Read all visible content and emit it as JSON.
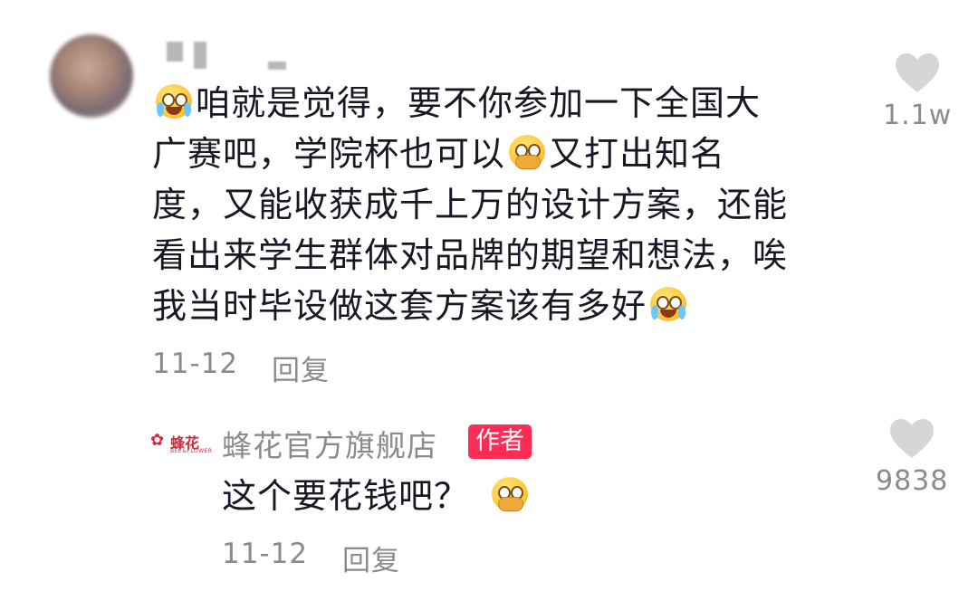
{
  "comment": {
    "text_lines": [
      [
        "咱就是觉得，要不你参加一下全国大"
      ],
      [
        "广赛吧，学院杯也可以",
        "又打出知名"
      ],
      [
        "度，又能收获成千上万的设计方案，还能"
      ],
      [
        "看出来学生群体对品牌的期望和想法，唉"
      ],
      [
        "我当时毕设做这套方案该有多好"
      ]
    ],
    "date": "11-12",
    "reply_label": "回复",
    "like_count": "1.1w"
  },
  "reply": {
    "logo_text": "蜂花",
    "logo_subtext": "BEE&FLOWER",
    "author_name": "蜂花官方旗舰店",
    "author_badge": "作者",
    "text": "这个要花钱吧？",
    "date": "11-12",
    "reply_label": "回复",
    "like_count": "9838"
  },
  "icons": {
    "heart": "heart-icon",
    "emoji_crying": "crying-face-emoji",
    "emoji_shy": "shy-covering-mouth-emoji"
  },
  "colors": {
    "accent_badge": "#fe2c55",
    "meta_gray": "#8a8a8f",
    "heart_gray": "#d6d6d8",
    "text": "#161823",
    "brand_red": "#d12a3a"
  }
}
